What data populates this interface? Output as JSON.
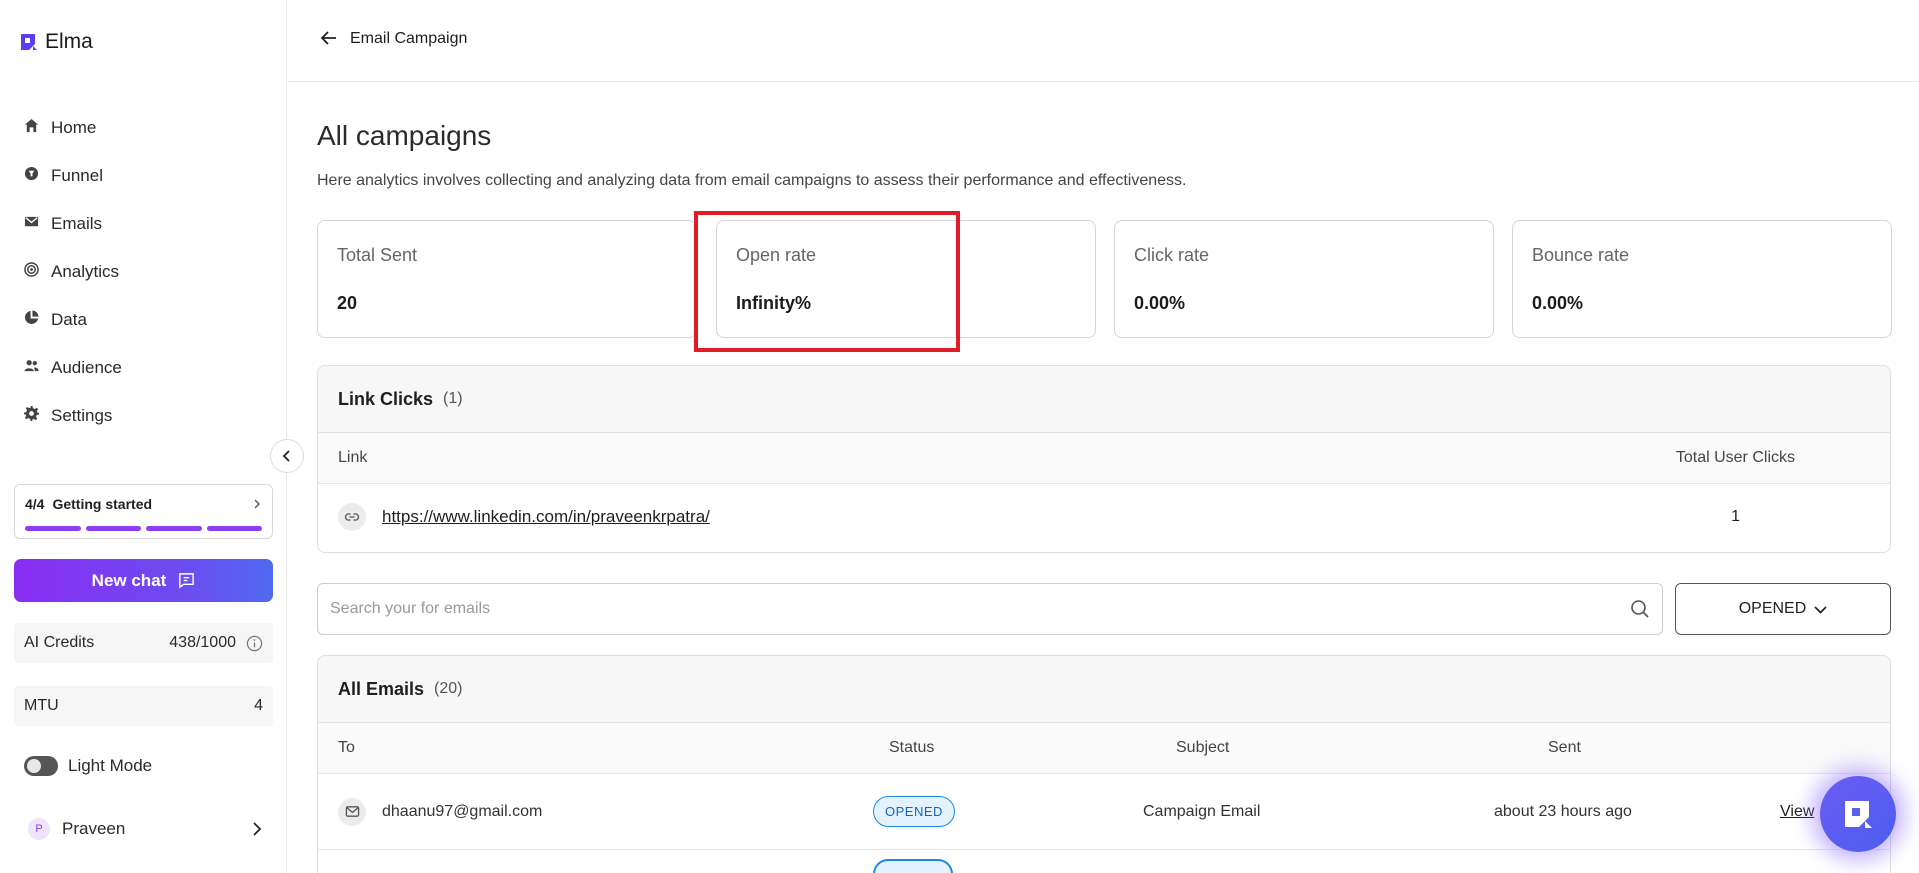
{
  "app": {
    "name": "Elma"
  },
  "sidebar": {
    "nav": [
      {
        "label": "Home",
        "icon": "home-icon"
      },
      {
        "label": "Funnel",
        "icon": "funnel-icon"
      },
      {
        "label": "Emails",
        "icon": "mail-icon"
      },
      {
        "label": "Analytics",
        "icon": "analytics-icon"
      },
      {
        "label": "Data",
        "icon": "pie-chart-icon"
      },
      {
        "label": "Audience",
        "icon": "users-icon"
      },
      {
        "label": "Settings",
        "icon": "gear-icon"
      }
    ],
    "getting_started": {
      "count": "4/4",
      "label": "Getting started",
      "steps_completed": 4,
      "steps_total": 4
    },
    "new_chat": "New chat",
    "credits": {
      "label": "AI Credits",
      "value": "438/1000"
    },
    "mtu": {
      "label": "MTU",
      "value": "4"
    },
    "light_mode": {
      "label": "Light Mode",
      "enabled": false
    },
    "user": {
      "name": "Praveen",
      "initial": "P"
    }
  },
  "header": {
    "breadcrumb": "Email Campaign"
  },
  "main": {
    "title": "All campaigns",
    "description": "Here analytics involves collecting and analyzing data from email campaigns to assess their performance and effectiveness.",
    "stats": [
      {
        "label": "Total Sent",
        "value": "20"
      },
      {
        "label": "Open rate",
        "value": "Infinity%"
      },
      {
        "label": "Click rate",
        "value": "0.00%"
      },
      {
        "label": "Bounce rate",
        "value": "0.00%"
      }
    ],
    "link_clicks": {
      "title": "Link Clicks",
      "count": "(1)",
      "columns": [
        "Link",
        "Total User Clicks"
      ],
      "rows": [
        {
          "url": "https://www.linkedin.com/in/praveenkrpatra/",
          "clicks": "1"
        }
      ]
    },
    "search": {
      "placeholder": "Search your for emails",
      "value": ""
    },
    "filter": {
      "selected": "OPENED"
    },
    "emails": {
      "title": "All Emails",
      "count": "(20)",
      "columns": [
        "To",
        "Status",
        "Subject",
        "Sent"
      ],
      "rows": [
        {
          "to": "dhaanu97@gmail.com",
          "status": "OPENED",
          "subject": "Campaign Email",
          "sent": "about 23 hours ago",
          "action": "View"
        }
      ]
    }
  },
  "colors": {
    "accent": "#8b3ff0",
    "highlight": "#e01b2a",
    "badge": "#1e88e5"
  }
}
